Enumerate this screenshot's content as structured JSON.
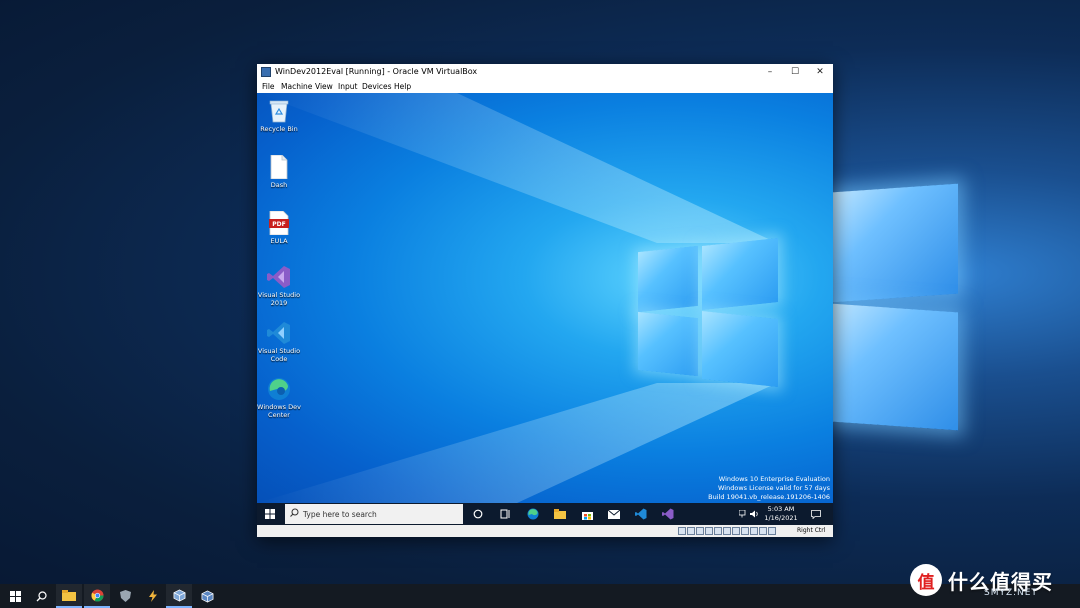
{
  "vm_window": {
    "title": "WinDev2012Eval [Running] - Oracle VM VirtualBox",
    "menu": [
      "File",
      "Machine",
      "View",
      "Input",
      "Devices",
      "Help"
    ],
    "controls": {
      "minimize": "–",
      "maximize": "☐",
      "close": "✕"
    }
  },
  "guest": {
    "desktop_icons": [
      {
        "label": "Recycle Bin",
        "icon": "recycle-bin-icon"
      },
      {
        "label": "Dash",
        "icon": "text-file-icon"
      },
      {
        "label": "EULA",
        "icon": "pdf-icon"
      },
      {
        "label": "Visual Studio 2019",
        "icon": "visual-studio-icon"
      },
      {
        "label": "Visual Studio Code",
        "icon": "vscode-icon"
      },
      {
        "label": "Windows Dev Center",
        "icon": "edge-icon"
      }
    ],
    "eval_text": [
      "Windows 10 Enterprise Evaluation",
      "Windows License valid for 57 days",
      "Build 19041.vb_release.191206-1406"
    ],
    "taskbar": {
      "search_placeholder": "Type here to search",
      "clock_time": "5:03 AM",
      "clock_date": "1/16/2021"
    }
  },
  "vm_status": {
    "host_key": "Right Ctrl"
  },
  "watermark": {
    "logo_char": "值",
    "text": "什么值得买",
    "sub": "SMYZ.NET"
  }
}
